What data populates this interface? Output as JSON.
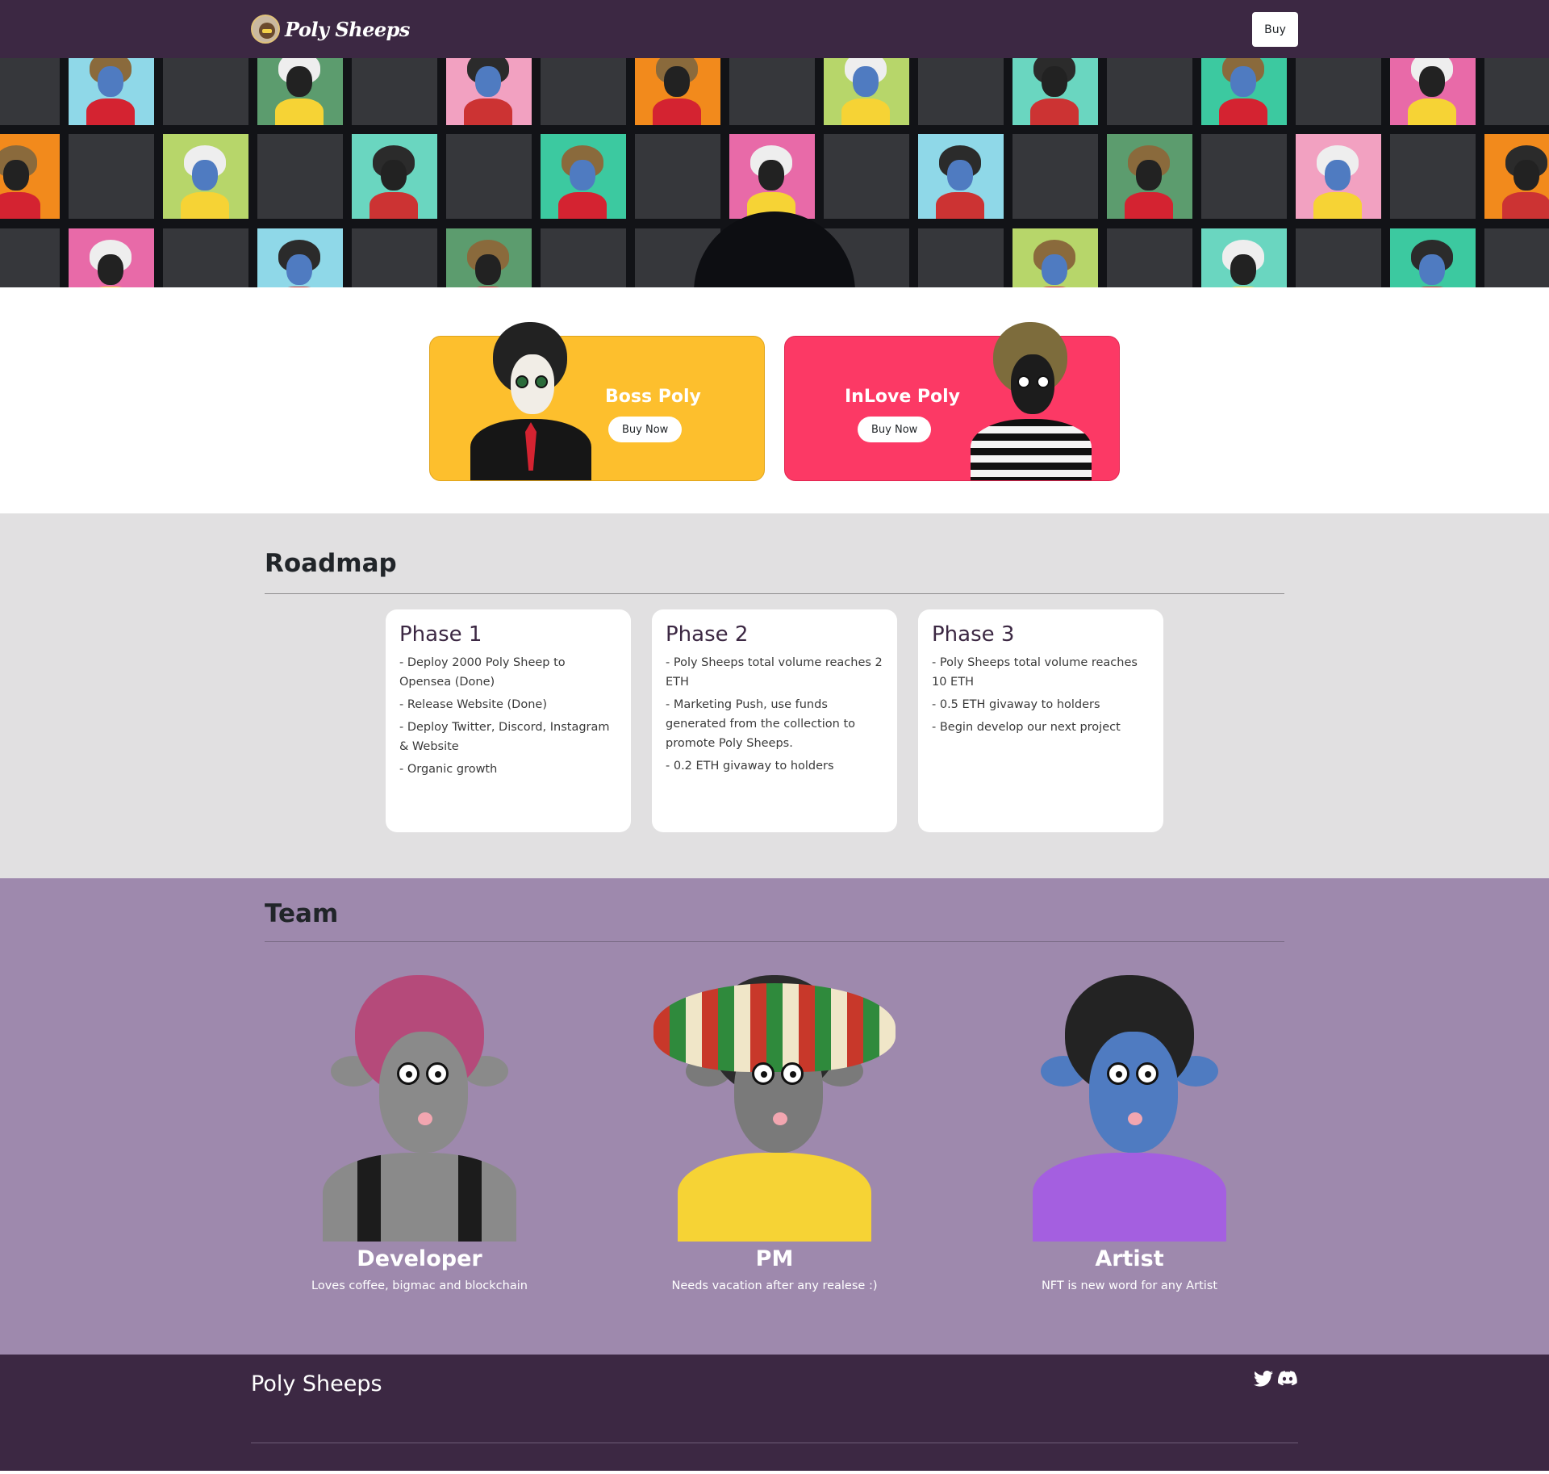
{
  "navbar": {
    "brand": "Poly Sheeps",
    "logo_icon": "sheep-logo-icon",
    "buy_label": "Buy"
  },
  "hero": {
    "description_icon": "sheep-avatar-mosaic"
  },
  "buy_cards": [
    {
      "title": "Boss Poly",
      "button": "Buy Now",
      "color": "#fdbf2d"
    },
    {
      "title": "InLove Poly",
      "button": "Buy Now",
      "color": "#fc3965"
    }
  ],
  "roadmap": {
    "title": "Roadmap",
    "phases": [
      {
        "title": "Phase 1",
        "items": [
          "- Deploy 2000 Poly Sheep to Opensea (Done)",
          "- Release Website (Done)",
          "- Deploy Twitter, Discord, Instagram & Website",
          "- Organic growth"
        ]
      },
      {
        "title": "Phase 2",
        "items": [
          "- Poly Sheeps total volume reaches 2 ETH",
          "- Marketing Push, use funds generated from the collection to promote Poly Sheeps.",
          "- 0.2 ETH givaway to holders"
        ]
      },
      {
        "title": "Phase 3",
        "items": [
          "- Poly Sheeps total volume reaches 10 ETH",
          "- 0.5 ETH givaway to holders",
          "- Begin develop our next project"
        ]
      }
    ]
  },
  "team": {
    "title": "Team",
    "members": [
      {
        "role": "Developer",
        "bio": "Loves coffee, bigmac and blockchain"
      },
      {
        "role": "PM",
        "bio": "Needs vacation after any realese :)"
      },
      {
        "role": "Artist",
        "bio": "NFT is new word for any Artist"
      }
    ]
  },
  "footer": {
    "brand": "Poly Sheeps",
    "social": [
      "twitter-icon",
      "discord-icon"
    ]
  },
  "colors": {
    "nav_bg": "#3c2843",
    "roadmap_bg": "#e1e0e1",
    "team_bg": "#9e89ad",
    "boss_card": "#fdbf2d",
    "love_card": "#fc3965"
  }
}
